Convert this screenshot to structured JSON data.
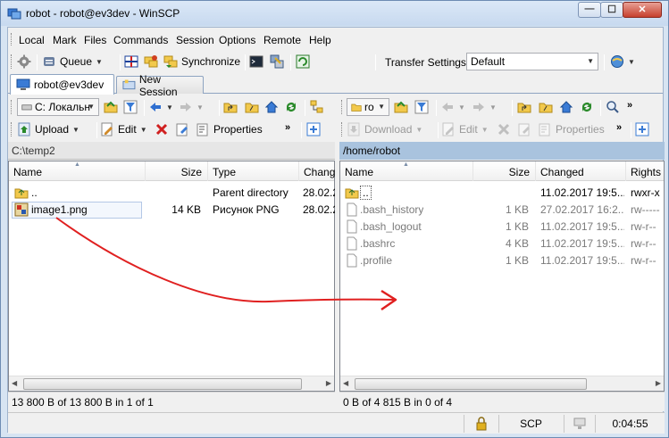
{
  "window": {
    "title": "robot - robot@ev3dev - WinSCP",
    "min_glyph": "—",
    "max_glyph": "☐",
    "close_glyph": "✕"
  },
  "menu": [
    "Local",
    "Mark",
    "Files",
    "Commands",
    "Session",
    "Options",
    "Remote",
    "Help"
  ],
  "toolbar1": {
    "queue_label": "Queue",
    "synchronize_label": "Synchronize",
    "transfer_settings_label": "Transfer Settings",
    "transfer_preset": "Default"
  },
  "tabs": [
    {
      "label": "robot@ev3dev",
      "active": true
    },
    {
      "label": "New Session",
      "active": false
    }
  ],
  "left_panel": {
    "drive": "C: Локальн",
    "upload_label": "Upload",
    "edit_label": "Edit",
    "properties_label": "Properties",
    "path": "C:\\temp2",
    "columns": [
      "Name",
      "Size",
      "Type",
      "Chang"
    ],
    "rows": [
      {
        "name": "..",
        "size": "",
        "type": "Parent directory",
        "changed": "28.02.2",
        "icon": "parent-folder-icon"
      },
      {
        "name": "image1.png",
        "size": "14 KB",
        "type": "Рисунок PNG",
        "changed": "28.02.2",
        "icon": "png-file-icon"
      }
    ],
    "status": "13 800 B of 13 800 B in 1 of 1"
  },
  "right_panel": {
    "drive": "ro",
    "download_label": "Download",
    "edit_label": "Edit",
    "properties_label": "Properties",
    "path": "/home/robot",
    "columns": [
      "Name",
      "Size",
      "Changed",
      "Rights"
    ],
    "rows": [
      {
        "name": "..",
        "size": "",
        "changed": "11.02.2017 19:5...",
        "rights": "rwxr-x",
        "icon": "parent-folder-icon"
      },
      {
        "name": ".bash_history",
        "size": "1 KB",
        "changed": "27.02.2017 16:2...",
        "rights": "rw-----",
        "icon": "file-icon"
      },
      {
        "name": ".bash_logout",
        "size": "1 KB",
        "changed": "11.02.2017 19:5...",
        "rights": "rw-r--",
        "icon": "file-icon"
      },
      {
        "name": ".bashrc",
        "size": "4 KB",
        "changed": "11.02.2017 19:5...",
        "rights": "rw-r--",
        "icon": "file-icon"
      },
      {
        "name": ".profile",
        "size": "1 KB",
        "changed": "11.02.2017 19:5...",
        "rights": "rw-r--",
        "icon": "file-icon"
      }
    ],
    "status": "0 B of 4 815 B in 0 of 4"
  },
  "statusbar": {
    "protocol": "SCP",
    "elapsed": "0:04:55"
  },
  "colors": {
    "selection_border": "#b4c8e6",
    "remote_path_bar": "#a9c3de",
    "annotation_arrow": "#e02020"
  }
}
